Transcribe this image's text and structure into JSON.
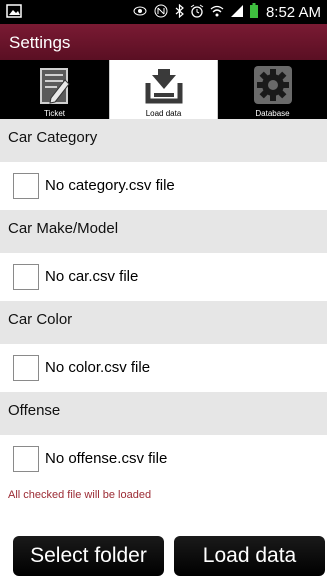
{
  "status_bar": {
    "time": "8:52 AM",
    "icons": [
      "image-notification-icon",
      "eye-icon",
      "nfc-icon",
      "bluetooth-icon",
      "alarm-icon",
      "wifi-icon",
      "signal-icon",
      "battery-icon"
    ],
    "colors": {
      "battery": "#3fbf3f"
    }
  },
  "appbar": {
    "title": "Settings",
    "color": "#6a1529"
  },
  "tabs": [
    {
      "label": "Ticket",
      "icon": "ticket-edit-icon",
      "selected": false
    },
    {
      "label": "Load data",
      "icon": "load-data-icon",
      "selected": true
    },
    {
      "label": "Database",
      "icon": "gear-icon",
      "selected": false
    }
  ],
  "sections": [
    {
      "header": "Car Category",
      "item": "No category.csv file",
      "checked": false
    },
    {
      "header": "Car Make/Model",
      "item": "No car.csv file",
      "checked": false
    },
    {
      "header": "Car Color",
      "item": "No color.csv file",
      "checked": false
    },
    {
      "header": "Offense",
      "item": "No offense.csv file",
      "checked": false
    }
  ],
  "note": "All checked file will be loaded",
  "buttons": {
    "select_folder": "Select folder",
    "load_data": "Load data"
  }
}
